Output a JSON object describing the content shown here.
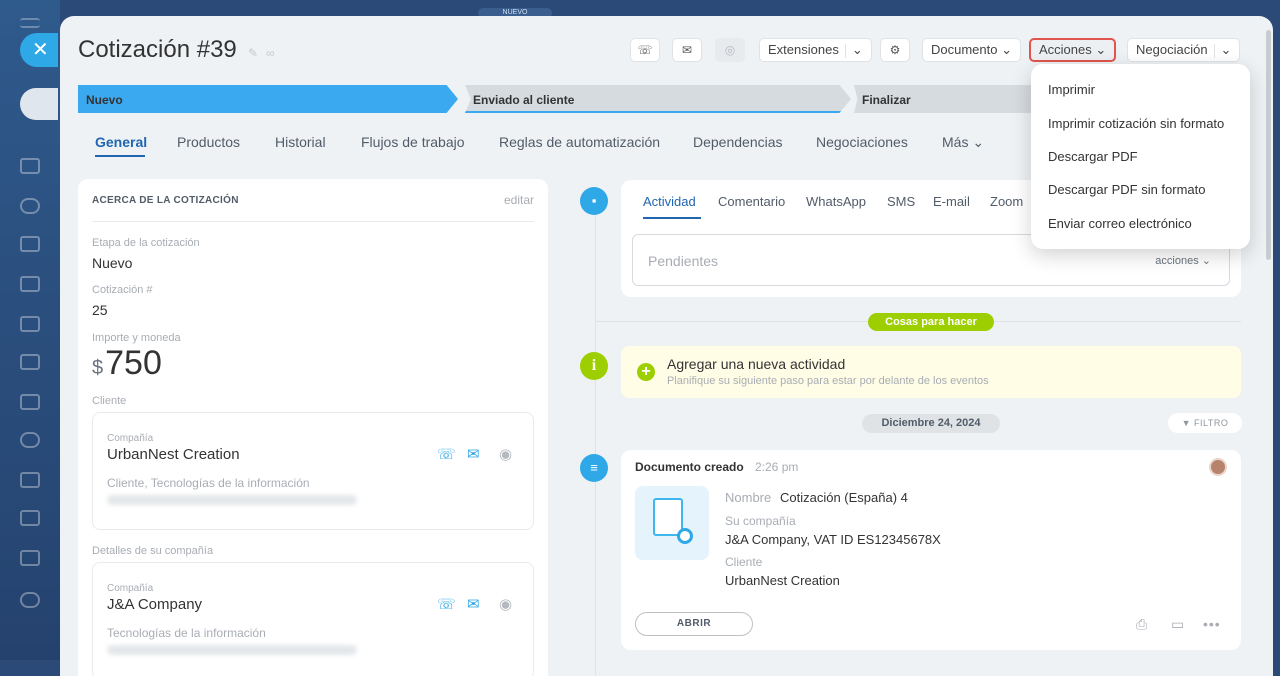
{
  "app": {
    "top_badge": "NUEVO"
  },
  "header": {
    "title": "Cotización #39",
    "extensions_label": "Extensiones",
    "document_label": "Documento",
    "actions_label": "Acciones",
    "deal_label": "Negociación"
  },
  "stages": [
    "Nuevo",
    "Enviado al cliente",
    "Finalizar"
  ],
  "tabs": [
    "General",
    "Productos",
    "Historial",
    "Flujos de trabajo",
    "Reglas de automatización",
    "Dependencias",
    "Negociaciones",
    "Más"
  ],
  "about": {
    "heading": "ACERCA DE LA COTIZACIÓN",
    "edit": "editar",
    "stage_label": "Etapa de la cotización",
    "stage_value": "Nuevo",
    "number_label": "Cotización #",
    "number_value": "25",
    "amount_label": "Importe y moneda",
    "currency": "$",
    "amount": "750",
    "client_label": "Cliente",
    "client": {
      "type": "Compañía",
      "name": "UrbanNest Creation",
      "desc": "Cliente, Tecnologías de la información"
    },
    "company_label": "Detalles de su compañía",
    "company": {
      "type": "Compañía",
      "name": "J&A Company",
      "desc": "Tecnologías de la información"
    }
  },
  "activity": {
    "tabs": [
      "Actividad",
      "Comentario",
      "WhatsApp",
      "SMS",
      "E-mail",
      "Zoom"
    ],
    "pending_placeholder": "Pendientes",
    "actions": "acciones"
  },
  "todo": {
    "pill": "Cosas para hacer",
    "title": "Agregar una nueva actividad",
    "subtitle": "Planifique su siguiente paso para estar por delante de los eventos"
  },
  "date_pill": "Diciembre 24, 2024",
  "filter": "FILTRO",
  "doc": {
    "title": "Documento creado",
    "time": "2:26 pm",
    "name_label": "Nombre",
    "name_value": "Cotización (España) 4",
    "company_label": "Su compañía",
    "company_value": "J&A Company, VAT ID ES12345678X",
    "client_label": "Cliente",
    "client_value": "UrbanNest Creation",
    "open_label": "ABRIR"
  },
  "actions_menu": [
    "Imprimir",
    "Imprimir cotización sin formato",
    "Descargar PDF",
    "Descargar PDF sin formato",
    "Enviar correo electrónico"
  ],
  "colors": {
    "accent": "#2066b0",
    "stage_active": "#3ba9ef",
    "green": "#9dcf00",
    "highlight": "#e0554d"
  }
}
